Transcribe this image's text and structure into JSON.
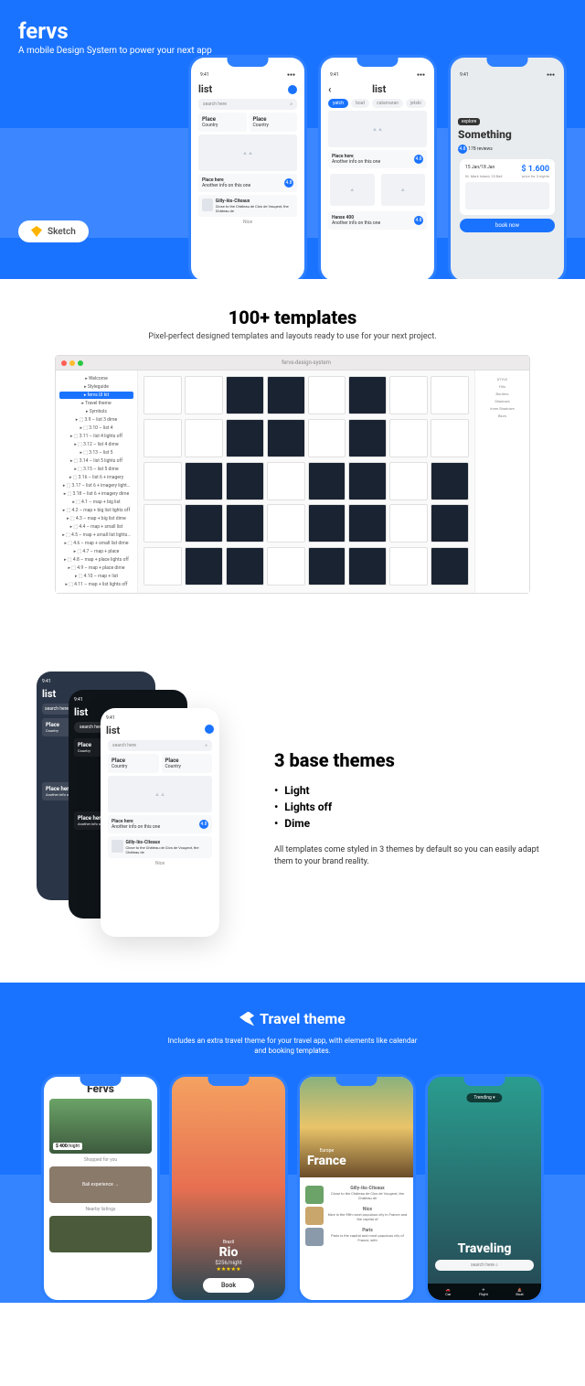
{
  "hero": {
    "title": "fervs",
    "subtitle": "A mobile Design System to power your next app",
    "sketch_btn": "Sketch"
  },
  "phone_common": {
    "time": "9:41",
    "list_title": "list",
    "search_placeholder": "search here",
    "place": "Place",
    "country": "Country",
    "place_here": "Place here",
    "another_info": "Another info on this one",
    "gilly": "Gilly-lès-Cîteaux",
    "gilly_sub": "Close to the Château de Clos de Vougeot, the Château de",
    "nice": "Nice"
  },
  "phone2": {
    "pills": [
      "yatch",
      "boat",
      "catamaran",
      "jetski"
    ],
    "hanse": "Hanse 400"
  },
  "phone3": {
    "explore": "explore",
    "something": "Something",
    "rating": "4.8",
    "reviews": "178 reviews",
    "dates": "15 Jan/18 Jan",
    "location": "St. Mark Island, 23 Bali",
    "price": "$ 1.600",
    "price_sub": "price for 3 nights",
    "book": "book now"
  },
  "templates": {
    "heading": "100+ templates",
    "sub": "Pixel-perfect designed templates and layouts ready to use for your next project.",
    "window_title": "fervs-design-system",
    "sidebar": [
      "Welcome",
      "Styleguide",
      "fervs UI kit",
      "Travel theme",
      "Symbols",
      "3.9 – list 3 dime",
      "3.10 – list 4",
      "3.11 – list 4 lights off",
      "3.12 – list 4 dime",
      "3.13 – list 5",
      "3.14 – list 5 lights off",
      "3.15 – list 5 dime",
      "3.16 – list 6 + imagery",
      "3.17 – list 6 + imagery light…",
      "3.18 – list 6 + imagery dime",
      "4.1 – map + big list",
      "4.2 – map + big list lights off",
      "4.3 – map + big list dime",
      "4.4 – map + small list",
      "4.5 – map + small list lights…",
      "4.6 – map + small list dime",
      "4.7 – map + place",
      "4.8 – map + place lights off",
      "4.9 – map + place dime",
      "4.10 – map + list",
      "4.11 – map + list lights off"
    ],
    "inspector": [
      "STYLE",
      "Fills",
      "Borders",
      "Shadows",
      "Inner Shadows",
      "Blurs"
    ]
  },
  "themes": {
    "heading": "3 base themes",
    "items": [
      "Light",
      "Lights off",
      "Dime"
    ],
    "desc": "All templates come styled in 3 themes by default so you can easily adapt them to your brand reality."
  },
  "travel": {
    "heading": "Travel theme",
    "sub": "Includes an extra travel theme for your travel app, with elements like calendar and booking templates.",
    "p1": {
      "title": "Fervs",
      "price": "$ 400",
      "unit": "/night",
      "shop": "Shopped for you",
      "nearby": "Nearby listings"
    },
    "p2": {
      "country": "Brazil",
      "city": "Rio",
      "price": "$256/night",
      "book": "Book"
    },
    "p3": {
      "region": "Europe",
      "country": "France",
      "items": [
        "Gilly-lès-Cîteaux",
        "Nice",
        "Paris"
      ]
    },
    "p4": {
      "trending": "Trending",
      "title": "Traveling",
      "search": "search here",
      "nav": [
        "Car",
        "Flight",
        "Boat"
      ]
    }
  }
}
